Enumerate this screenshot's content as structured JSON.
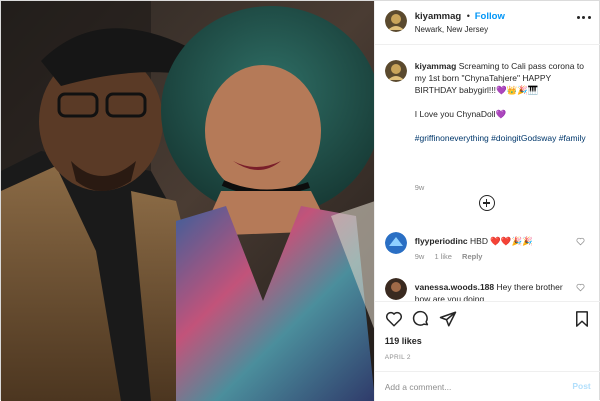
{
  "header": {
    "username": "kiyammag",
    "separator": "•",
    "follow_label": "Follow",
    "location": "Newark, New Jersey"
  },
  "caption": {
    "username": "kiyammag",
    "line1": "Screaming to Cali pass corona to my 1st born \"ChynaTahjere\" HAPPY BIRTHDAY babygirl!!!💜👑🎉🎹",
    "line2": "I Love you ChynaDoll💜",
    "hashtags": "#griffinoneverything #doingitGodsway #family",
    "time": "9w"
  },
  "comments": [
    {
      "username": "flyyperiodinc",
      "text": "HBD ❤️❤️🎉🎉",
      "time": "9w",
      "likes": "1 like",
      "reply_label": "Reply"
    },
    {
      "username": "vanessa.woods.188",
      "text": "Hey there brother how are you doing"
    }
  ],
  "likes": "119 likes",
  "date": "APRIL 2",
  "add_comment": {
    "placeholder": "Add a comment...",
    "post_label": "Post"
  },
  "colors": {
    "follow": "#0095f6",
    "hashtag": "#00376b",
    "muted": "#8e8e8e",
    "post_disabled": "#b2dffc"
  },
  "icons": [
    "more-options-icon",
    "load-more-comments-icon",
    "heart-icon",
    "comment-icon",
    "share-icon",
    "bookmark-icon"
  ]
}
